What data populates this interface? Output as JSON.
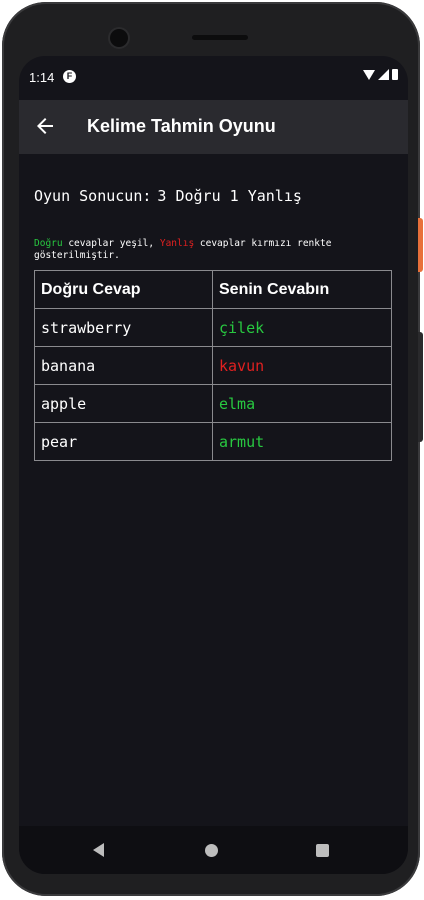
{
  "status_bar": {
    "time": "1:14",
    "app_icon": "F",
    "icons": [
      "wifi-icon",
      "signal-icon",
      "battery-icon"
    ]
  },
  "app_bar": {
    "title": "Kelime Tahmin Oyunu",
    "back_icon": "arrow-left-icon"
  },
  "result": {
    "label": "Oyun Sonucun:",
    "value": "3 Doğru 1 Yanlış"
  },
  "legend": {
    "correct_word": "Doğru",
    "text1": " cevaplar yeşil, ",
    "wrong_word": "Yanlış",
    "text2": " cevaplar kırmızı renkte gösterilmiştir."
  },
  "table": {
    "headers": [
      "Doğru Cevap",
      "Senin Cevabın"
    ],
    "rows": [
      {
        "correct": "strawberry",
        "answer": "çilek",
        "is_correct": true
      },
      {
        "correct": "banana",
        "answer": "kavun",
        "is_correct": false
      },
      {
        "correct": "apple",
        "answer": "elma",
        "is_correct": true
      },
      {
        "correct": "pear",
        "answer": "armut",
        "is_correct": true
      }
    ]
  },
  "colors": {
    "correct": "#28c840",
    "wrong": "#e02020",
    "background": "#14141a",
    "app_bar": "#2a2a2f"
  },
  "nav_bar": {
    "icons": [
      "nav-back-icon",
      "nav-home-icon",
      "nav-recents-icon"
    ]
  }
}
